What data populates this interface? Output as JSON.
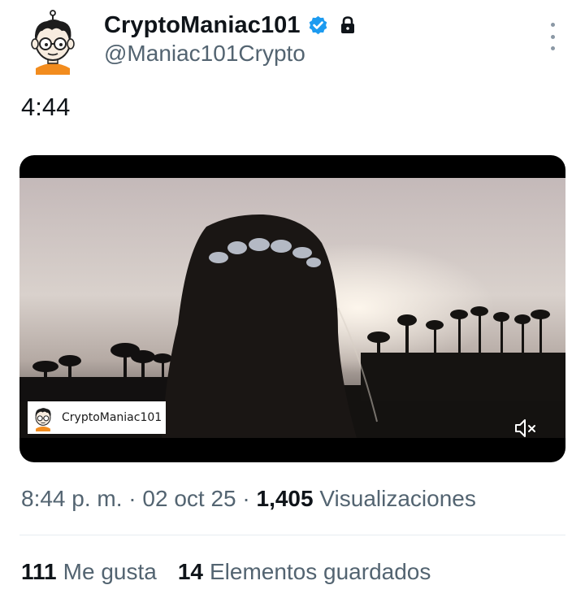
{
  "author": {
    "display_name": "CryptoManiac101",
    "handle": "@Maniac101Crypto",
    "verified_icon": "verified-badge-icon",
    "protected_icon": "lock-icon",
    "accent_color": "#1d9bf0"
  },
  "tweet": {
    "text": "4:44"
  },
  "media": {
    "type": "video",
    "watermark_name": "CryptoManiac101",
    "mute_icon": "volume-muted-icon"
  },
  "meta": {
    "time": "8:44 p. m.",
    "separator": "·",
    "date": "02 oct 25",
    "views_count": "1,405",
    "views_label": "Visualizaciones"
  },
  "stats": {
    "likes_count": "111",
    "likes_label": "Me gusta",
    "bookmarks_count": "14",
    "bookmarks_label": "Elementos guardados"
  },
  "menu_icon": "more-vertical-icon"
}
